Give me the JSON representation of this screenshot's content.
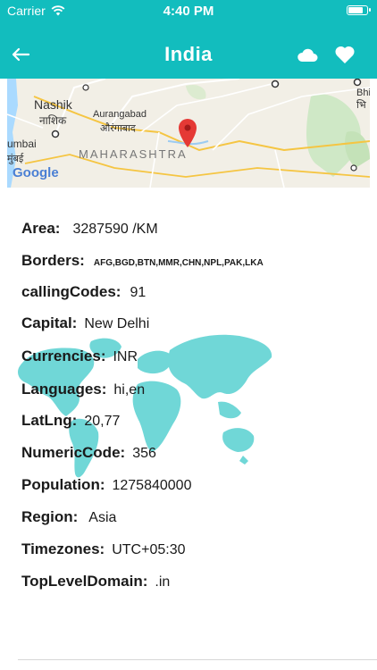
{
  "status": {
    "carrier": "Carrier",
    "time": "4:40 PM"
  },
  "nav": {
    "title": "India"
  },
  "map": {
    "labels": {
      "nashik": "Nashik",
      "nashik_local": "नाशिक",
      "aurangabad": "Aurangabad",
      "aurangabad_local": "औरंगाबाद",
      "maharashtra": "MAHARASHTRA",
      "mumbai_partial": "umbai",
      "mumbai_local_partial": "मुंबई",
      "bhi_partial": "Bhi",
      "bhi_local_partial": "भि",
      "google": "Google"
    }
  },
  "details": [
    {
      "key": "Area:",
      "value": "3287590 /KM"
    },
    {
      "key": "Borders:",
      "value": "AFG,BGD,BTN,MMR,CHN,NPL,PAK,LKA"
    },
    {
      "key": "callingCodes:",
      "value": "91"
    },
    {
      "key": "Capital:",
      "value": "New Delhi"
    },
    {
      "key": "Currencies:",
      "value": "INR"
    },
    {
      "key": "Languages:",
      "value": "hi,en"
    },
    {
      "key": "LatLng:",
      "value": "20,77"
    },
    {
      "key": "NumericCode:",
      "value": "356"
    },
    {
      "key": "Population:",
      "value": "1275840000"
    },
    {
      "key": "Region:",
      "value": "Asia"
    },
    {
      "key": "Timezones:",
      "value": "UTC+05:30"
    },
    {
      "key": "TopLevelDomain:",
      "value": ".in"
    }
  ],
  "colors": {
    "accent": "#12BDBE",
    "pin": "#E53935",
    "world": "#12BDBE"
  }
}
